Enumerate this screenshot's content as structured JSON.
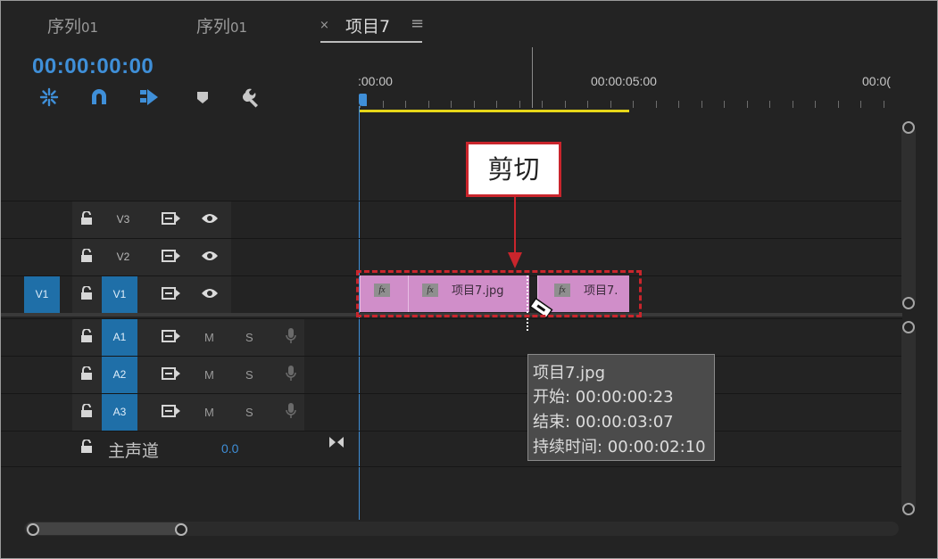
{
  "tabs": [
    {
      "label": "序列",
      "num": "01"
    },
    {
      "label": "序列",
      "num": "01"
    },
    {
      "label": "项目7",
      "close": "×",
      "menu": "≡",
      "active": true
    }
  ],
  "timecode": "00:00:00:00",
  "toolbar_icons": [
    "nest-sequence-icon",
    "snap-magnet-icon",
    "linked-selection-icon",
    "add-marker-icon",
    "wrench-settings-icon"
  ],
  "ruler": {
    "labels": [
      ":00:00",
      "00:00:05:00",
      "00:0("
    ]
  },
  "tracks": {
    "video": [
      {
        "name": "V3",
        "source_patch": "",
        "targeted": false
      },
      {
        "name": "V2",
        "source_patch": "",
        "targeted": false
      },
      {
        "name": "V1",
        "source_patch": "V1",
        "targeted": true
      }
    ],
    "audio": [
      {
        "name": "A1",
        "mute": "M",
        "solo": "S"
      },
      {
        "name": "A2",
        "mute": "M",
        "solo": "S"
      },
      {
        "name": "A3",
        "mute": "M",
        "solo": "S"
      }
    ],
    "master": {
      "label": "主声道",
      "value": "0.0"
    }
  },
  "clips": [
    {
      "fx": "fx",
      "name": ""
    },
    {
      "fx": "fx",
      "name": "项目7.jpg"
    },
    {
      "fx": "fx",
      "name": "项目7."
    }
  ],
  "tooltip": {
    "name": "项目7.jpg",
    "start": "开始: 00:00:00:23",
    "end": "结束: 00:00:03:07",
    "duration": "持续时间: 00:00:02:10"
  },
  "callout": {
    "label": "剪切"
  },
  "colors": {
    "clip": "#d08ec9",
    "timecode": "#3f8fd8",
    "workarea": "#e6d619",
    "patch": "#1f6fa8",
    "callout_border": "#c9252c"
  }
}
